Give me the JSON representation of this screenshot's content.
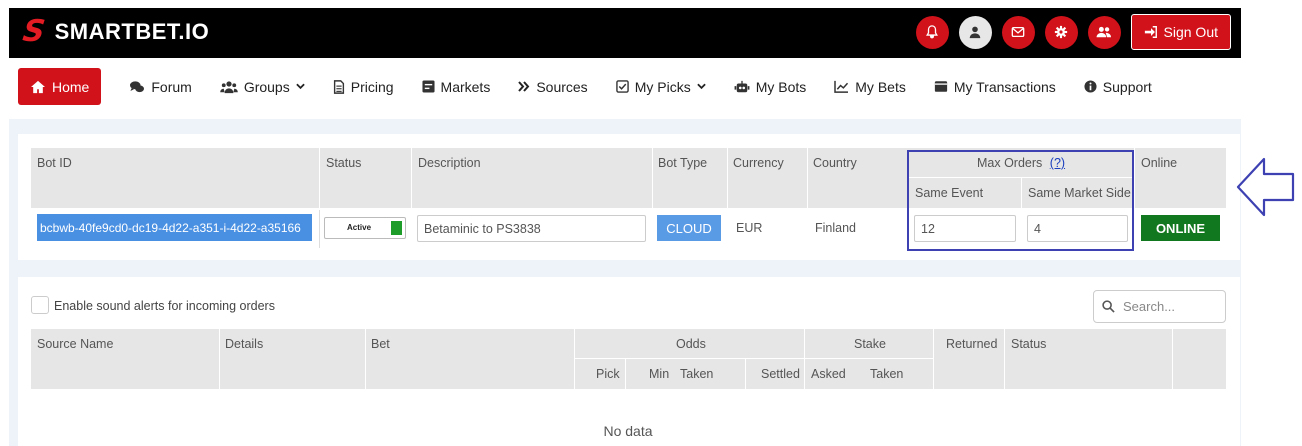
{
  "brand": {
    "logo_mark": "S",
    "name": "SMARTBET.IO",
    "accent": "#d1121b"
  },
  "top_icons": [
    "bell-icon",
    "user-icon",
    "mail-icon",
    "gear-icon",
    "users-icon"
  ],
  "sign_out_label": "Sign Out",
  "nav": [
    {
      "label": "Home",
      "icon": "home-icon",
      "active": true
    },
    {
      "label": "Forum",
      "icon": "comments-icon"
    },
    {
      "label": "Groups",
      "icon": "users-icon",
      "dropdown": true
    },
    {
      "label": "Pricing",
      "icon": "file-icon"
    },
    {
      "label": "Markets",
      "icon": "list-icon"
    },
    {
      "label": "Sources",
      "icon": "double-chevron-icon"
    },
    {
      "label": "My Picks",
      "icon": "checkbox-icon",
      "dropdown": true
    },
    {
      "label": "My Bots",
      "icon": "robot-icon"
    },
    {
      "label": "My Bets",
      "icon": "chart-icon"
    },
    {
      "label": "My Transactions",
      "icon": "wallet-icon"
    },
    {
      "label": "Support",
      "icon": "info-icon"
    }
  ],
  "bots_table": {
    "headers": {
      "bot_id": "Bot ID",
      "status": "Status",
      "description": "Description",
      "bot_type": "Bot Type",
      "currency": "Currency",
      "country": "Country",
      "max_orders": "Max Orders",
      "max_orders_help": "(?)",
      "same_event": "Same Event",
      "same_market_side": "Same Market Side",
      "online": "Online"
    },
    "row": {
      "bot_id": "bcbwb-40fe9cd0-dc19-4d22-a351-i-4d22-a35166",
      "status": "Active",
      "description": "Betaminic to PS3838",
      "bot_type": "CLOUD",
      "currency": "EUR",
      "country": "Finland",
      "same_event": "12",
      "same_market_side": "4",
      "online": "ONLINE"
    }
  },
  "orders": {
    "sound_alerts_label": "Enable sound alerts for incoming orders",
    "search_placeholder": "Search...",
    "headers": {
      "source_name": "Source Name",
      "details": "Details",
      "bet": "Bet",
      "odds": "Odds",
      "stake": "Stake",
      "returned": "Returned",
      "status": "Status",
      "pick": "Pick",
      "min": "Min",
      "taken": "Taken",
      "settled": "Settled",
      "asked": "Asked",
      "stake_taken": "Taken"
    },
    "empty_text": "No data"
  }
}
